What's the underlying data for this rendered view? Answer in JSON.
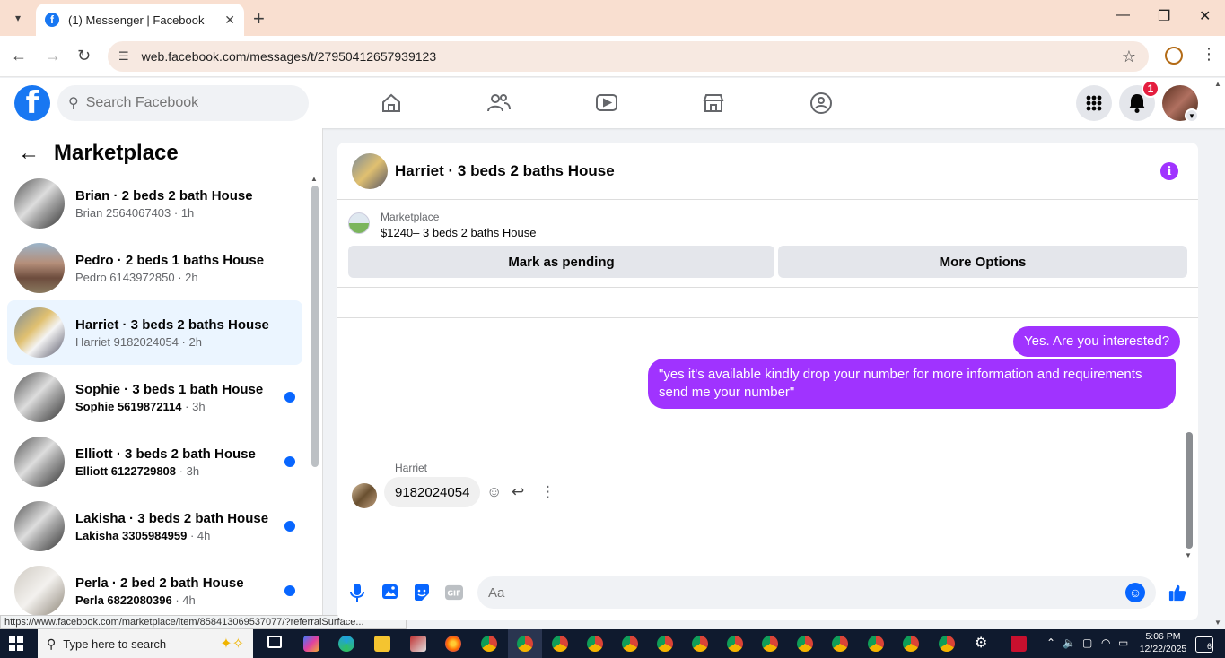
{
  "browser": {
    "tab_title": "(1) Messenger | Facebook",
    "tab_favicon": "f",
    "url": "web.facebook.com/messages/t/27950412657939123",
    "status_url": "https://www.facebook.com/marketplace/item/858413069537077/?referralSurface..."
  },
  "fbnav": {
    "logo": "f",
    "search_placeholder": "Search Facebook",
    "notification_count": "1"
  },
  "sidebar": {
    "title": "Marketplace",
    "conversations": [
      {
        "name": "Brian · 2 beds 2 bath House",
        "contact": "Brian 2564067403",
        "time": " · 1h",
        "unread": false,
        "active": false
      },
      {
        "name": "Pedro · 2 beds 1 baths House",
        "contact": "Pedro 6143972850",
        "time": " · 2h",
        "unread": false,
        "active": false
      },
      {
        "name": "Harriet · 3 beds 2 baths House",
        "contact": "Harriet 9182024054",
        "time": " · 2h",
        "unread": false,
        "active": true
      },
      {
        "name": "Sophie · 3 beds 1 bath House",
        "contact": "Sophie 5619872114",
        "time": " · 3h",
        "unread": true,
        "active": false
      },
      {
        "name": "Elliott · 3 beds 2 bath House",
        "contact": "Elliott 6122729808",
        "time": " · 3h",
        "unread": true,
        "active": false
      },
      {
        "name": "Lakisha · 3 beds 2 bath House",
        "contact": "Lakisha 3305984959",
        "time": " · 4h",
        "unread": true,
        "active": false
      },
      {
        "name": "Perla · 2 bed 2 bath House",
        "contact": "Perla 6822080396",
        "time": " · 4h",
        "unread": true,
        "active": false
      }
    ]
  },
  "chat": {
    "title": "Harriet · 3 beds 2 baths House",
    "listing_label": "Marketplace",
    "listing_price": "$1240– 3 beds 2 baths House",
    "mark_pending_label": "Mark as pending",
    "more_options_label": "More Options",
    "messages_out": [
      "Yes. Are you interested?",
      "\"yes it's available kindly drop your number for more information and requirements send me your number\""
    ],
    "incoming_sender": "Harriet",
    "incoming_message": "9182024054",
    "composer_placeholder": "Aa"
  },
  "taskbar": {
    "search_placeholder": "Type here to search",
    "time": "5:06 PM",
    "date": "12/22/2025",
    "notifications": "6"
  },
  "colors": {
    "fb_blue": "#1877f2",
    "messenger_purple": "#a033ff",
    "unread_dot": "#0866ff",
    "badge_red": "#e41e3f"
  }
}
